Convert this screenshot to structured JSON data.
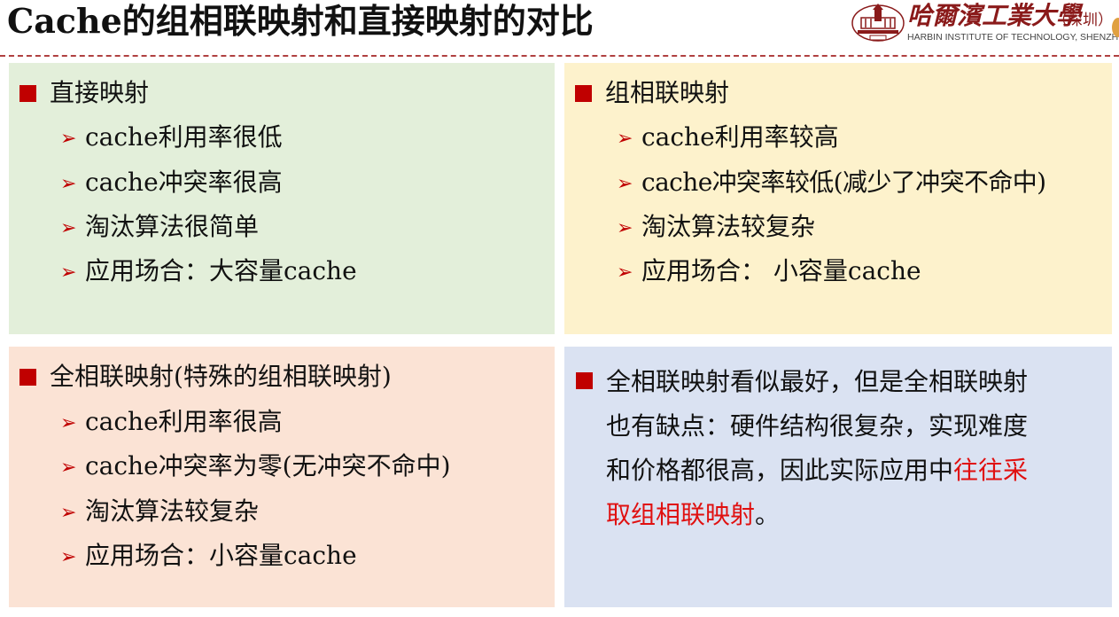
{
  "title": "Cache的组相联映射和直接映射的对比",
  "logo": {
    "name_cn": "哈爾濱工業大學",
    "campus": "（深圳）",
    "name_en": "HARBIN INSTITUTE OF TECHNOLOGY, SHENZHEN"
  },
  "panels": [
    {
      "heading": "直接映射",
      "items": [
        "cache利用率很低",
        "cache冲突率很高",
        "淘汰算法很简单",
        "应用场合：大容量cache"
      ]
    },
    {
      "heading": "组相联映射",
      "items": [
        "cache利用率较高",
        "cache冲突率较低(减少了冲突不命中)",
        "淘汰算法较复杂",
        "应用场合： 小容量cache"
      ]
    },
    {
      "heading": "全相联映射(特殊的组相联映射)",
      "items": [
        "cache利用率很高",
        "cache冲突率为零(无冲突不命中)",
        "淘汰算法较复杂",
        "应用场合：小容量cache"
      ]
    }
  ],
  "note": {
    "line1": "全相联映射看似最好，但是全相联映射",
    "line2": "也有缺点：硬件结构很复杂，实现难度",
    "line3_plain": "和价格都很高，因此实际应用中",
    "line3_red": "往往采",
    "line4_red": "取组相联映射",
    "line4_end": "。"
  },
  "colors": {
    "panel_green": "#e3efda",
    "panel_yellow": "#fdf2cc",
    "panel_peach": "#fbe3d5",
    "panel_blue": "#dae2f2",
    "bullet_red": "#c00000",
    "highlight_red": "#e01010"
  }
}
